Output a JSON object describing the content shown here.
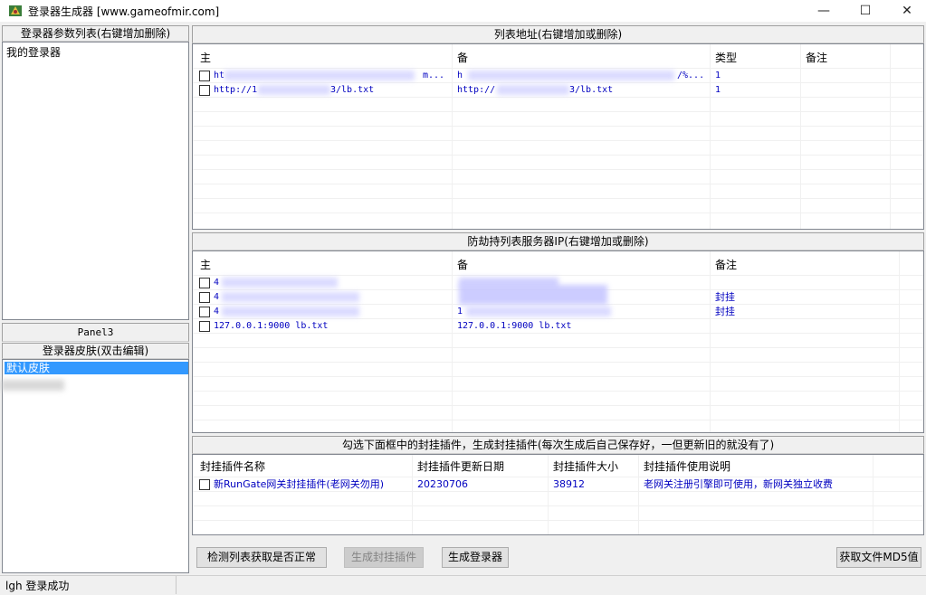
{
  "window": {
    "title": "登录器生成器 [www.gameofmir.com]",
    "minimize": "—",
    "maximize": "☐",
    "close": "✕"
  },
  "left": {
    "params_header": "登录器参数列表(右键增加删除)",
    "params_items": [
      "我的登录器"
    ],
    "panel3_label": "Panel3",
    "skin_header": "登录器皮肤(双击编辑)",
    "skin_items": [
      "默认皮肤"
    ]
  },
  "list_addr": {
    "header": "列表地址(右键增加或删除)",
    "columns": [
      "主",
      "备",
      "类型",
      "备注"
    ],
    "rows": [
      {
        "main": "ht",
        "main_tail": "m...",
        "backup": "h",
        "backup_tail": "/%...",
        "type": "1",
        "note": ""
      },
      {
        "main": "http://1",
        "main_tail": "3/lb.txt",
        "backup": "http://",
        "backup_tail": "3/lb.txt",
        "type": "1",
        "note": ""
      }
    ]
  },
  "anti_hijack": {
    "header": "防劫持列表服务器IP(右键增加或删除)",
    "columns": [
      "主",
      "备",
      "备注"
    ],
    "rows": [
      {
        "main": "4",
        "backup": "",
        "note": ""
      },
      {
        "main": "4",
        "backup": "",
        "note": "封挂"
      },
      {
        "main": "4",
        "backup": "1",
        "note": "封挂"
      },
      {
        "main": "127.0.0.1:9000 lb.txt",
        "backup": "127.0.0.1:9000 lb.txt",
        "note": ""
      }
    ]
  },
  "plugins": {
    "header": "勾选下面框中的封挂插件，生成封挂插件(每次生成后自己保存好，一但更新旧的就没有了)",
    "columns": [
      "封挂插件名称",
      "封挂插件更新日期",
      "封挂插件大小",
      "封挂插件使用说明"
    ],
    "rows": [
      {
        "name": "新RunGate网关封挂插件(老网关勿用)",
        "date": "20230706",
        "size": "38912",
        "desc": "老网关注册引擎即可使用，新网关独立收费"
      }
    ]
  },
  "buttons": {
    "check_list": "检测列表获取是否正常",
    "gen_plugin": "生成封挂插件",
    "gen_launcher": "生成登录器",
    "get_md5": "获取文件MD5值"
  },
  "status": {
    "text": "lgh 登录成功"
  }
}
